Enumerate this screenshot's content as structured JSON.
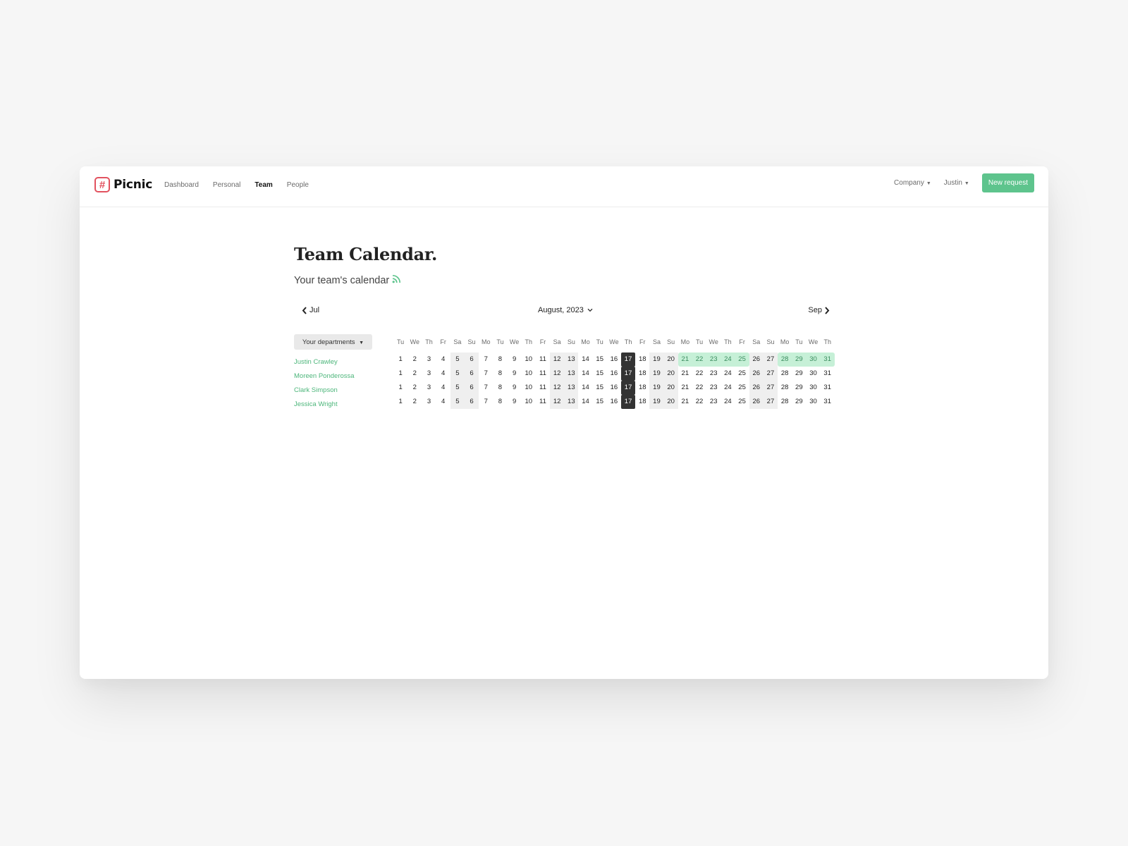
{
  "app": {
    "logo_text": "Picnic",
    "logo_glyph": "#",
    "brand_color": "#e2525f",
    "accent_color": "#5ec48d"
  },
  "nav": {
    "items": [
      {
        "label": "Dashboard",
        "active": false
      },
      {
        "label": "Personal",
        "active": false
      },
      {
        "label": "Team",
        "active": true
      },
      {
        "label": "People",
        "active": false
      }
    ],
    "company_label": "Company",
    "user_label": "Justin",
    "new_request_label": "New request"
  },
  "page": {
    "title": "Team Calendar.",
    "subtitle": "Your team's calendar",
    "rss_icon": "rss-icon"
  },
  "calendar": {
    "prev_label": "Jul",
    "next_label": "Sep",
    "month_label": "August, 2023",
    "departments_label": "Your departments",
    "weekdays": [
      "Tu",
      "We",
      "Th",
      "Fr",
      "Sa",
      "Su",
      "Mo",
      "Tu",
      "We",
      "Th",
      "Fr",
      "Sa",
      "Su",
      "Mo",
      "Tu",
      "We",
      "Th",
      "Fr",
      "Sa",
      "Su",
      "Mo",
      "Tu",
      "We",
      "Th",
      "Fr",
      "Sa",
      "Su",
      "Mo",
      "Tu",
      "We",
      "Th"
    ],
    "today": 17,
    "members": [
      {
        "name": "Justin Crawley",
        "leave_days": [
          21,
          22,
          23,
          24,
          25,
          28,
          29,
          30,
          31
        ]
      },
      {
        "name": "Moreen Ponderossa",
        "leave_days": []
      },
      {
        "name": "Clark Simpson",
        "leave_days": []
      },
      {
        "name": "Jessica Wright",
        "leave_days": []
      }
    ]
  }
}
